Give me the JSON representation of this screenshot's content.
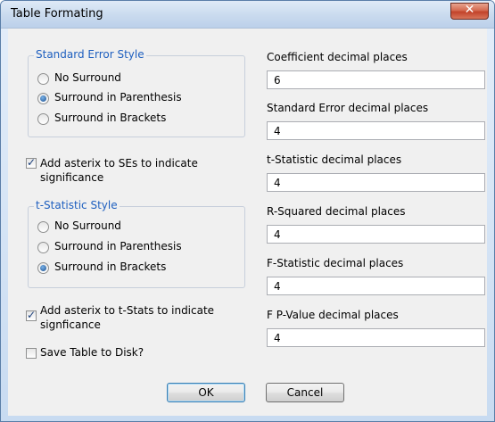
{
  "window": {
    "title": "Table Formating",
    "close_glyph": "✕"
  },
  "se_style": {
    "title": "Standard Error Style",
    "options": [
      {
        "label": "No Surround",
        "selected": false
      },
      {
        "label": "Surround in Parenthesis",
        "selected": true
      },
      {
        "label": "Surround in Brackets",
        "selected": false
      }
    ]
  },
  "se_asterisk": {
    "label_line1": "Add asterix to SEs to indicate",
    "label_line2": "significance",
    "checked": true
  },
  "t_style": {
    "title": "t-Statistic Style",
    "options": [
      {
        "label": "No Surround",
        "selected": false
      },
      {
        "label": "Surround in Parenthesis",
        "selected": false
      },
      {
        "label": "Surround in Brackets",
        "selected": true
      }
    ]
  },
  "t_asterisk": {
    "label_line1": "Add asterix to t-Stats to indicate",
    "label_line2": "signficance",
    "checked": true
  },
  "save_disk": {
    "label": "Save Table to Disk?",
    "checked": false
  },
  "fields": [
    {
      "label": "Coefficient decimal places",
      "value": "6"
    },
    {
      "label": "Standard Error decimal places",
      "value": "4"
    },
    {
      "label": "t-Statistic decimal places",
      "value": "4"
    },
    {
      "label": "R-Squared decimal places",
      "value": "4"
    },
    {
      "label": "F-Statistic decimal places",
      "value": "4"
    },
    {
      "label": "F P-Value decimal places",
      "value": "4"
    }
  ],
  "buttons": {
    "ok": "OK",
    "cancel": "Cancel"
  }
}
